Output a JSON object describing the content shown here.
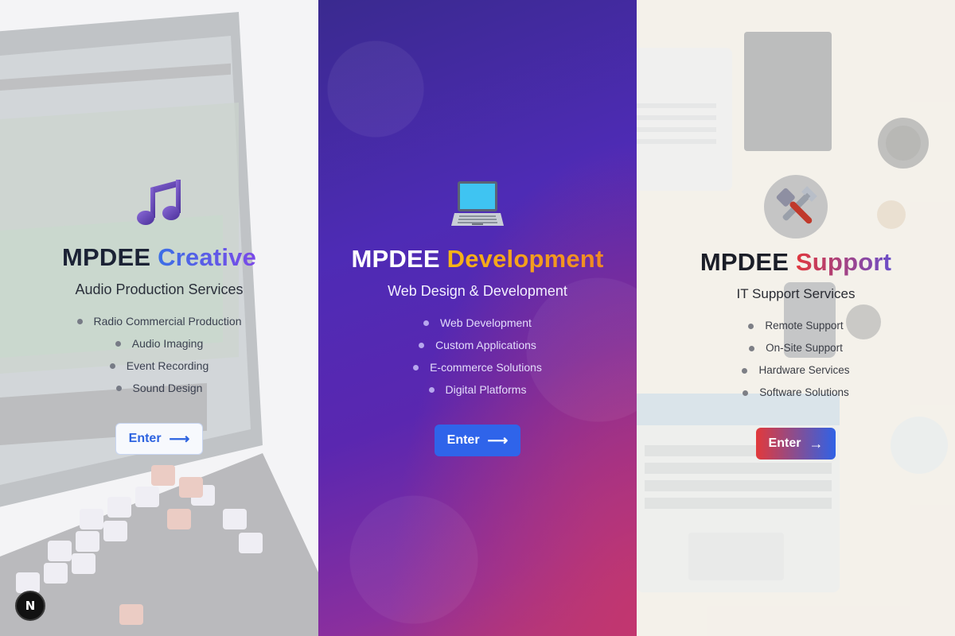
{
  "panels": {
    "creative": {
      "title_prefix": "MPDEE",
      "title_accent": "Creative",
      "subtitle": "Audio Production Services",
      "features": [
        "Radio Commercial Production",
        "Audio Imaging",
        "Event Recording",
        "Sound Design"
      ],
      "enter_label": "Enter",
      "arrow": "⟶",
      "icon": "music-note-icon"
    },
    "development": {
      "title_prefix": "MPDEE",
      "title_accent": "Development",
      "subtitle": "Web Design & Development",
      "features": [
        "Web Development",
        "Custom Applications",
        "E-commerce Solutions",
        "Digital Platforms"
      ],
      "enter_label": "Enter",
      "arrow": "⟶",
      "icon": "laptop-icon"
    },
    "support": {
      "title_prefix": "MPDEE",
      "title_accent": "Support",
      "subtitle": "IT Support Services",
      "features": [
        "Remote Support",
        "On-Site Support",
        "Hardware Services",
        "Software Solutions"
      ],
      "enter_label": "Enter",
      "arrow": "→",
      "icon": "tools-icon"
    }
  },
  "badge": {
    "label": "N",
    "icon": "nextjs-logo-icon"
  },
  "colors": {
    "creative_accent": "#3b6fe6",
    "development_bg": "#4e2bb5",
    "development_accent": "#f7b515",
    "support_accent_start": "#e0373d",
    "support_accent_end": "#6a4dc9",
    "button_blue": "#2f64ea"
  }
}
